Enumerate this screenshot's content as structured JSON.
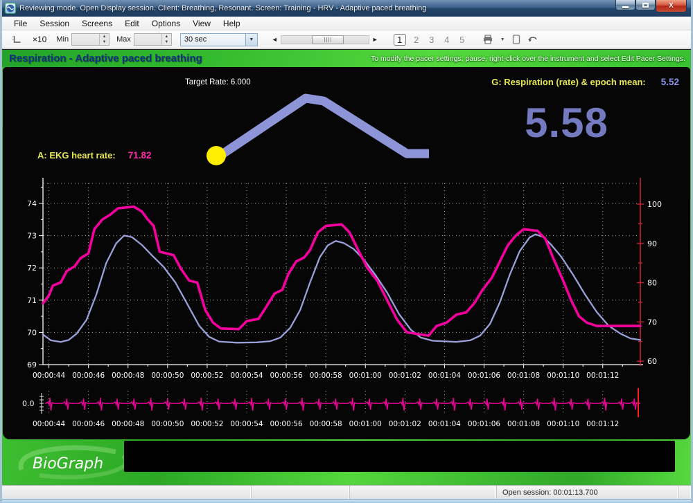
{
  "window": {
    "title": "Reviewing mode. Open Display session. Client: Breathing, Resonant. Screen: Training - HRV - Adaptive paced breathing"
  },
  "menu": {
    "items": [
      "File",
      "Session",
      "Screens",
      "Edit",
      "Options",
      "View",
      "Help"
    ]
  },
  "toolbar": {
    "zoom_label": "×10",
    "min_label": "Min",
    "min_value": "",
    "max_label": "Max",
    "max_value": "",
    "time_scale_value": "30 sec",
    "pages": [
      "1",
      "2",
      "3",
      "4",
      "5"
    ],
    "active_page": "1"
  },
  "header": {
    "title": "Respiration - Adaptive paced breathing",
    "hint": "To modify the pacer settings, pause, right-click over the instrument and select Edit Pacer Settings."
  },
  "instrument": {
    "target_rate_label": "Target Rate: 6.000",
    "respiration_label": "G: Respiration (rate) & epoch mean:",
    "respiration_epoch_mean": "5.52",
    "respiration_value": "5.58",
    "heart_rate_label": "A: EKG heart rate:",
    "heart_rate_value": "71.82",
    "pacer_ball_color": "#ffee00",
    "pacer_ramp_color": "#8d95d8",
    "label_color": "#e6e656",
    "epoch_value_color": "#8a90e8",
    "big_value_color": "#747ac0",
    "hr_value_color": "#ff2aa8"
  },
  "status_bar": {
    "open_session": "Open session: 00:01:13.700"
  },
  "watermark": "BioGraph",
  "chart_data": [
    {
      "type": "line",
      "title": "HRV training: EKG heart rate and respiration",
      "x_tick_labels": [
        "00:00:44",
        "00:00:46",
        "00:00:48",
        "00:00:50",
        "00:00:52",
        "00:00:54",
        "00:00:56",
        "00:00:58",
        "00:01:00",
        "00:01:02",
        "00:01:04",
        "00:01:06",
        "00:01:08",
        "00:01:10",
        "00:01:12"
      ],
      "x_tick_seconds": [
        44,
        46,
        48,
        50,
        52,
        54,
        56,
        58,
        60,
        62,
        64,
        66,
        68,
        70,
        72
      ],
      "x_range_seconds": [
        43.7,
        73.9
      ],
      "grid": "dotted",
      "left_axis": {
        "ticks": [
          69,
          70,
          71,
          72,
          73,
          74
        ],
        "range": [
          69,
          74.6
        ],
        "color": "#ffffff"
      },
      "right_axis": {
        "ticks": [
          60,
          70,
          80,
          90,
          100
        ],
        "range": [
          60,
          102
        ],
        "color": "#c82333"
      },
      "series": [
        {
          "name": "Respiration",
          "axis": "right",
          "color": "#9aa0d8",
          "points": [
            [
              43.7,
              66.8
            ],
            [
              44.1,
              65.3
            ],
            [
              44.6,
              64.9
            ],
            [
              45.0,
              65.4
            ],
            [
              45.4,
              67.0
            ],
            [
              45.9,
              70.5
            ],
            [
              46.4,
              77.0
            ],
            [
              46.9,
              85.0
            ],
            [
              47.4,
              90.0
            ],
            [
              47.8,
              92.0
            ],
            [
              48.2,
              91.6
            ],
            [
              48.7,
              89.6
            ],
            [
              49.2,
              87.0
            ],
            [
              49.8,
              84.0
            ],
            [
              50.4,
              80.0
            ],
            [
              51.0,
              74.5
            ],
            [
              51.6,
              69.0
            ],
            [
              52.1,
              66.2
            ],
            [
              52.6,
              65.0
            ],
            [
              53.5,
              64.7
            ],
            [
              54.5,
              64.8
            ],
            [
              55.2,
              65.1
            ],
            [
              55.7,
              66.0
            ],
            [
              56.2,
              68.5
            ],
            [
              56.7,
              73.0
            ],
            [
              57.2,
              80.0
            ],
            [
              57.7,
              86.5
            ],
            [
              58.1,
              89.5
            ],
            [
              58.5,
              90.6
            ],
            [
              58.9,
              90.1
            ],
            [
              59.4,
              88.6
            ],
            [
              59.9,
              86.0
            ],
            [
              60.5,
              82.0
            ],
            [
              61.1,
              77.5
            ],
            [
              61.7,
              72.0
            ],
            [
              62.3,
              68.0
            ],
            [
              62.8,
              66.0
            ],
            [
              63.4,
              65.2
            ],
            [
              64.6,
              64.9
            ],
            [
              65.3,
              65.3
            ],
            [
              65.8,
              66.5
            ],
            [
              66.3,
              69.5
            ],
            [
              66.8,
              75.0
            ],
            [
              67.3,
              82.0
            ],
            [
              67.8,
              88.0
            ],
            [
              68.3,
              91.5
            ],
            [
              68.6,
              92.3
            ],
            [
              69.0,
              91.6
            ],
            [
              69.4,
              89.6
            ],
            [
              69.9,
              86.6
            ],
            [
              70.5,
              82.0
            ],
            [
              71.1,
              77.0
            ],
            [
              71.7,
              72.5
            ],
            [
              72.3,
              69.0
            ],
            [
              72.9,
              67.0
            ],
            [
              73.4,
              65.8
            ],
            [
              73.9,
              65.4
            ]
          ]
        },
        {
          "name": "EKG heart rate",
          "axis": "left",
          "color": "#f5009e",
          "points": [
            [
              43.7,
              70.9
            ],
            [
              44.0,
              71.15
            ],
            [
              44.2,
              71.45
            ],
            [
              44.6,
              71.55
            ],
            [
              44.9,
              71.9
            ],
            [
              45.3,
              72.05
            ],
            [
              45.6,
              72.3
            ],
            [
              46.0,
              72.45
            ],
            [
              46.3,
              73.2
            ],
            [
              46.7,
              73.5
            ],
            [
              47.1,
              73.65
            ],
            [
              47.5,
              73.85
            ],
            [
              48.3,
              73.9
            ],
            [
              48.7,
              73.75
            ],
            [
              49.0,
              73.5
            ],
            [
              49.3,
              73.3
            ],
            [
              49.6,
              72.5
            ],
            [
              50.3,
              72.4
            ],
            [
              50.7,
              71.95
            ],
            [
              51.1,
              71.6
            ],
            [
              51.5,
              71.55
            ],
            [
              51.9,
              70.7
            ],
            [
              52.3,
              70.3
            ],
            [
              52.7,
              70.12
            ],
            [
              53.6,
              70.1
            ],
            [
              54.0,
              70.35
            ],
            [
              54.6,
              70.42
            ],
            [
              55.0,
              70.8
            ],
            [
              55.4,
              71.2
            ],
            [
              55.8,
              71.32
            ],
            [
              56.1,
              71.8
            ],
            [
              56.5,
              72.2
            ],
            [
              56.9,
              72.32
            ],
            [
              57.2,
              72.55
            ],
            [
              57.6,
              73.1
            ],
            [
              58.0,
              73.3
            ],
            [
              58.8,
              73.35
            ],
            [
              59.2,
              73.1
            ],
            [
              59.6,
              72.6
            ],
            [
              60.1,
              72.0
            ],
            [
              60.6,
              71.6
            ],
            [
              61.1,
              71.0
            ],
            [
              61.6,
              70.4
            ],
            [
              62.1,
              70.0
            ],
            [
              63.2,
              69.9
            ],
            [
              63.6,
              70.2
            ],
            [
              64.1,
              70.3
            ],
            [
              64.6,
              70.55
            ],
            [
              65.1,
              70.62
            ],
            [
              65.5,
              70.9
            ],
            [
              65.9,
              71.3
            ],
            [
              66.4,
              71.7
            ],
            [
              66.8,
              72.2
            ],
            [
              67.2,
              72.7
            ],
            [
              67.6,
              73.0
            ],
            [
              68.0,
              73.2
            ],
            [
              68.7,
              73.15
            ],
            [
              69.1,
              72.9
            ],
            [
              69.5,
              72.3
            ],
            [
              70.0,
              71.6
            ],
            [
              70.4,
              71.0
            ],
            [
              70.8,
              70.5
            ],
            [
              71.2,
              70.3
            ],
            [
              71.7,
              70.2
            ],
            [
              73.9,
              70.2
            ]
          ]
        }
      ]
    },
    {
      "type": "line",
      "title": "Raw EKG",
      "baseline_label": "0.0",
      "baseline_value": 0.0,
      "color": "#f5009e",
      "cursor_color": "#ff1f1f",
      "x_tick_labels": [
        "00:00:44",
        "00:00:46",
        "00:00:48",
        "00:00:50",
        "00:00:52",
        "00:00:54",
        "00:00:56",
        "00:00:58",
        "00:01:00",
        "00:01:02",
        "00:01:04",
        "00:01:06",
        "00:01:08",
        "00:01:10",
        "00:01:12"
      ],
      "x_tick_seconds": [
        44,
        46,
        48,
        50,
        52,
        54,
        56,
        58,
        60,
        62,
        64,
        66,
        68,
        70,
        72
      ],
      "x_range_seconds": [
        43.7,
        73.9
      ],
      "spike_times_seconds": [
        44.05,
        44.9,
        45.75,
        46.6,
        47.45,
        48.3,
        49.15,
        50.0,
        50.85,
        51.7,
        52.55,
        53.4,
        54.25,
        55.1,
        55.95,
        56.8,
        57.65,
        58.5,
        59.35,
        60.2,
        61.05,
        61.9,
        62.75,
        63.6,
        64.45,
        65.3,
        66.15,
        67.0,
        67.85,
        68.7,
        69.55,
        70.4,
        71.25,
        72.1,
        72.95,
        73.6
      ]
    }
  ]
}
